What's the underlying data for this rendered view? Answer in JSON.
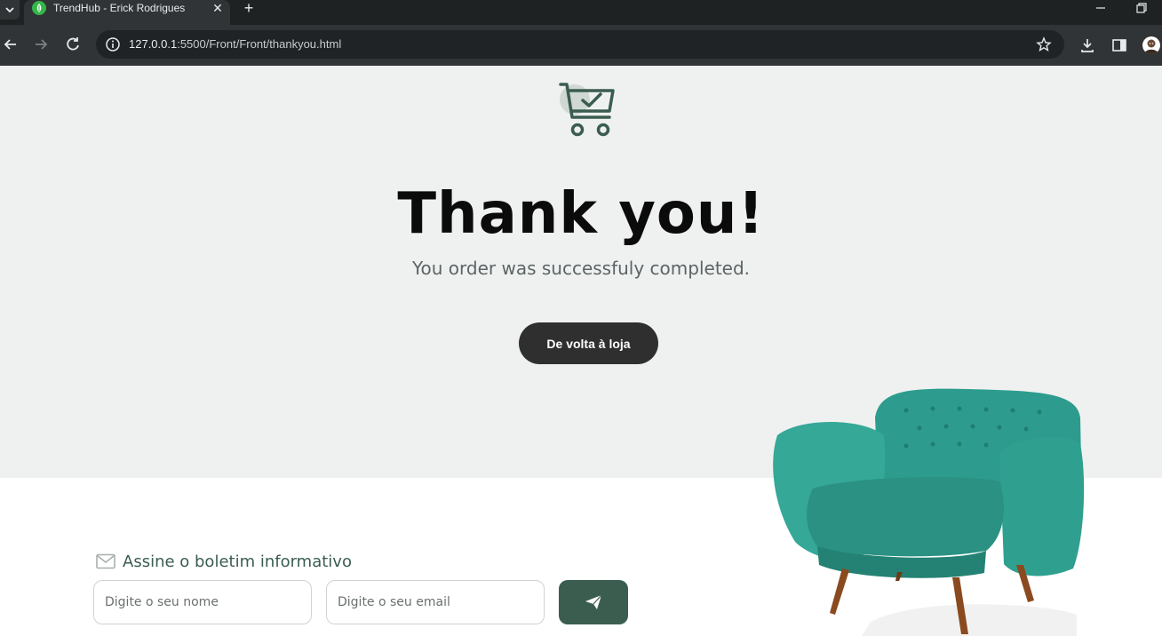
{
  "browser": {
    "tab_title": "TrendHub - Erick Rodrigues",
    "tab_close": "✕",
    "new_tab": "+",
    "url_host": "127.0.0.1",
    "url_path": ":5500/Front/Front/thankyou.html"
  },
  "page": {
    "heading": "Thank you!",
    "subtitle": "You order was successfuly completed.",
    "back_button": "De volta à loja"
  },
  "newsletter": {
    "title": "Assine o boletim informativo",
    "name_placeholder": "Digite o seu nome",
    "email_placeholder": "Digite o seu email"
  },
  "icons": {
    "cart": "cart-check-icon",
    "mail": "mail-icon",
    "send": "paper-plane-icon"
  },
  "colors": {
    "brand_green": "#3b5d50",
    "hero_bg": "#eff1f0",
    "button_dark": "#2f2f30",
    "sofa_teal": "#2f9e8f"
  }
}
